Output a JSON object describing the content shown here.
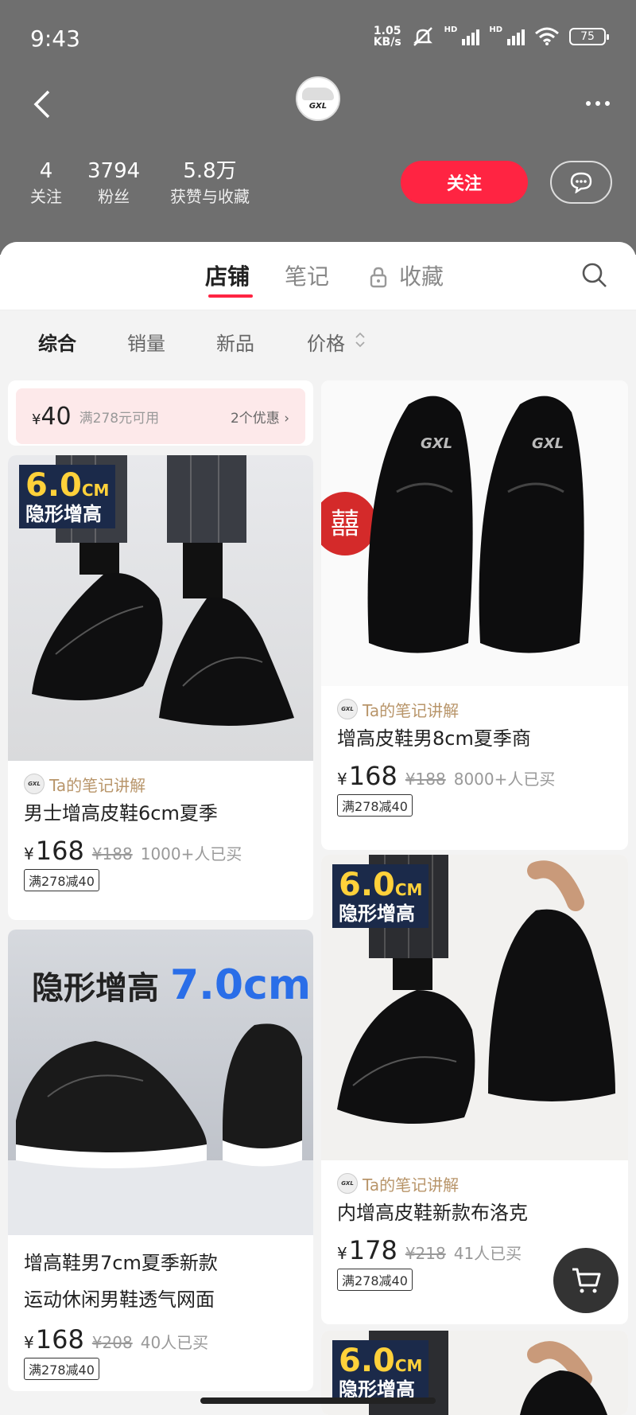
{
  "status_bar": {
    "time": "9:43",
    "net_speed_top": "1.05",
    "net_speed_bottom": "KB/s",
    "hd1": "HD",
    "hd2": "HD",
    "battery": "75"
  },
  "header": {
    "avatar_logo": "GXL"
  },
  "stats": [
    {
      "num": "4",
      "label": "关注"
    },
    {
      "num": "3794",
      "label": "粉丝"
    },
    {
      "num": "5.8万",
      "label": "获赞与收藏"
    }
  ],
  "follow_label": "关注",
  "tabs": {
    "shop": "店铺",
    "notes": "笔记",
    "favorites": "收藏"
  },
  "filters": {
    "all": "综合",
    "sales": "销量",
    "new": "新品",
    "price": "价格"
  },
  "coupon": {
    "yen": "¥",
    "amount": "40",
    "condition": "满278元可用",
    "more": "2个优惠 ›"
  },
  "products": [
    {
      "badge_big": "6.0",
      "badge_cm": "CM",
      "badge_sub": "隐形增高",
      "note": "Ta的笔记讲解",
      "title": "男士增高皮鞋6cm夏季",
      "yen": "¥",
      "price": "168",
      "orig": "¥188",
      "sold": "1000+人已买",
      "tag": "满278减40"
    },
    {
      "logo": "GXL",
      "note": "Ta的笔记讲解",
      "title": "增高皮鞋男8cm夏季商",
      "yen": "¥",
      "price": "168",
      "orig": "¥188",
      "sold": "8000+人已买",
      "tag": "满278减40"
    },
    {
      "banner_text": "隐形增高",
      "banner_num": "7.0cm",
      "title_line1": "增高鞋男7cm夏季新款",
      "title_line2": "运动休闲男鞋透气网面",
      "yen": "¥",
      "price": "168",
      "orig": "¥208",
      "sold": "40人已买",
      "tag": "满278减40"
    },
    {
      "badge_big": "6.0",
      "badge_cm": "CM",
      "badge_sub": "隐形增高",
      "note": "Ta的笔记讲解",
      "title": "内增高皮鞋新款布洛克",
      "yen": "¥",
      "price": "178",
      "orig": "¥218",
      "sold": "41人已买",
      "tag": "满278减40"
    },
    {
      "badge_big": "6.0",
      "badge_cm": "CM",
      "badge_sub": "隐形增高"
    }
  ],
  "colors": {
    "brand_red": "#ff2442",
    "header_gray": "#6f6f6f",
    "note_gold": "#b8956a"
  }
}
